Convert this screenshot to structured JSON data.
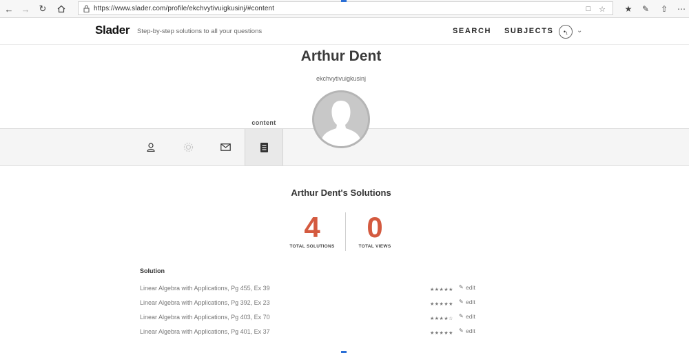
{
  "browser": {
    "url": "https://www.slader.com/profile/ekchvytivuigkusinj/#content"
  },
  "header": {
    "logo": "Slader",
    "tagline": "Step-by-step solutions to all your questions",
    "nav": {
      "search": "SEARCH",
      "subjects": "SUBJECTS"
    },
    "avatar_glyph": "•₁"
  },
  "profile": {
    "name": "Arthur Dent",
    "username": "ekchvytivuigkusinj",
    "active_tab_caption": "content",
    "tabs": [
      {
        "id": "profile",
        "icon": "user-icon"
      },
      {
        "id": "settings",
        "icon": "gear-icon"
      },
      {
        "id": "messages",
        "icon": "envelope-icon"
      },
      {
        "id": "content",
        "icon": "document-icon"
      }
    ]
  },
  "solutions": {
    "title": "Arthur Dent's Solutions",
    "stats": {
      "total_solutions": {
        "value": "4",
        "label": "TOTAL SOLUTIONS"
      },
      "total_views": {
        "value": "0",
        "label": "TOTAL VIEWS"
      }
    },
    "column_header": "Solution",
    "rows": [
      {
        "title": "Linear Algebra with Applications, Pg 455, Ex 39",
        "stars": "★★★★★",
        "edit": "edit"
      },
      {
        "title": "Linear Algebra with Applications, Pg 392, Ex 23",
        "stars": "★★★★★",
        "edit": "edit"
      },
      {
        "title": "Linear Algebra with Applications, Pg 403, Ex 70",
        "stars": "★★★★☆",
        "edit": "edit"
      },
      {
        "title": "Linear Algebra with Applications, Pg 401, Ex 37",
        "stars": "★★★★★",
        "edit": "edit"
      }
    ]
  },
  "colors": {
    "accent": "#d45a3f",
    "browser_mark": "#2b6fd6"
  }
}
